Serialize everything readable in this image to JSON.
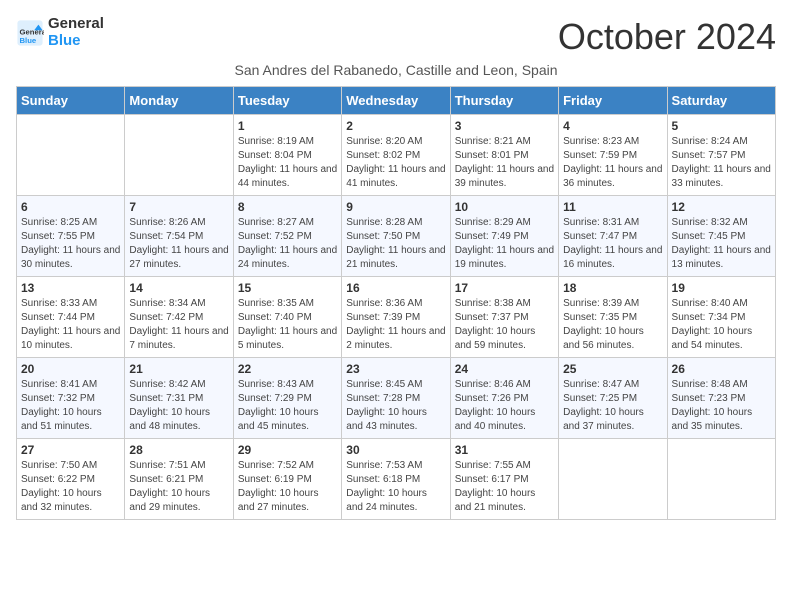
{
  "logo": {
    "line1": "General",
    "line2": "Blue"
  },
  "title": "October 2024",
  "subtitle": "San Andres del Rabanedo, Castille and Leon, Spain",
  "headers": [
    "Sunday",
    "Monday",
    "Tuesday",
    "Wednesday",
    "Thursday",
    "Friday",
    "Saturday"
  ],
  "weeks": [
    [
      {
        "day": "",
        "content": ""
      },
      {
        "day": "",
        "content": ""
      },
      {
        "day": "1",
        "content": "Sunrise: 8:19 AM\nSunset: 8:04 PM\nDaylight: 11 hours and 44 minutes."
      },
      {
        "day": "2",
        "content": "Sunrise: 8:20 AM\nSunset: 8:02 PM\nDaylight: 11 hours and 41 minutes."
      },
      {
        "day": "3",
        "content": "Sunrise: 8:21 AM\nSunset: 8:01 PM\nDaylight: 11 hours and 39 minutes."
      },
      {
        "day": "4",
        "content": "Sunrise: 8:23 AM\nSunset: 7:59 PM\nDaylight: 11 hours and 36 minutes."
      },
      {
        "day": "5",
        "content": "Sunrise: 8:24 AM\nSunset: 7:57 PM\nDaylight: 11 hours and 33 minutes."
      }
    ],
    [
      {
        "day": "6",
        "content": "Sunrise: 8:25 AM\nSunset: 7:55 PM\nDaylight: 11 hours and 30 minutes."
      },
      {
        "day": "7",
        "content": "Sunrise: 8:26 AM\nSunset: 7:54 PM\nDaylight: 11 hours and 27 minutes."
      },
      {
        "day": "8",
        "content": "Sunrise: 8:27 AM\nSunset: 7:52 PM\nDaylight: 11 hours and 24 minutes."
      },
      {
        "day": "9",
        "content": "Sunrise: 8:28 AM\nSunset: 7:50 PM\nDaylight: 11 hours and 21 minutes."
      },
      {
        "day": "10",
        "content": "Sunrise: 8:29 AM\nSunset: 7:49 PM\nDaylight: 11 hours and 19 minutes."
      },
      {
        "day": "11",
        "content": "Sunrise: 8:31 AM\nSunset: 7:47 PM\nDaylight: 11 hours and 16 minutes."
      },
      {
        "day": "12",
        "content": "Sunrise: 8:32 AM\nSunset: 7:45 PM\nDaylight: 11 hours and 13 minutes."
      }
    ],
    [
      {
        "day": "13",
        "content": "Sunrise: 8:33 AM\nSunset: 7:44 PM\nDaylight: 11 hours and 10 minutes."
      },
      {
        "day": "14",
        "content": "Sunrise: 8:34 AM\nSunset: 7:42 PM\nDaylight: 11 hours and 7 minutes."
      },
      {
        "day": "15",
        "content": "Sunrise: 8:35 AM\nSunset: 7:40 PM\nDaylight: 11 hours and 5 minutes."
      },
      {
        "day": "16",
        "content": "Sunrise: 8:36 AM\nSunset: 7:39 PM\nDaylight: 11 hours and 2 minutes."
      },
      {
        "day": "17",
        "content": "Sunrise: 8:38 AM\nSunset: 7:37 PM\nDaylight: 10 hours and 59 minutes."
      },
      {
        "day": "18",
        "content": "Sunrise: 8:39 AM\nSunset: 7:35 PM\nDaylight: 10 hours and 56 minutes."
      },
      {
        "day": "19",
        "content": "Sunrise: 8:40 AM\nSunset: 7:34 PM\nDaylight: 10 hours and 54 minutes."
      }
    ],
    [
      {
        "day": "20",
        "content": "Sunrise: 8:41 AM\nSunset: 7:32 PM\nDaylight: 10 hours and 51 minutes."
      },
      {
        "day": "21",
        "content": "Sunrise: 8:42 AM\nSunset: 7:31 PM\nDaylight: 10 hours and 48 minutes."
      },
      {
        "day": "22",
        "content": "Sunrise: 8:43 AM\nSunset: 7:29 PM\nDaylight: 10 hours and 45 minutes."
      },
      {
        "day": "23",
        "content": "Sunrise: 8:45 AM\nSunset: 7:28 PM\nDaylight: 10 hours and 43 minutes."
      },
      {
        "day": "24",
        "content": "Sunrise: 8:46 AM\nSunset: 7:26 PM\nDaylight: 10 hours and 40 minutes."
      },
      {
        "day": "25",
        "content": "Sunrise: 8:47 AM\nSunset: 7:25 PM\nDaylight: 10 hours and 37 minutes."
      },
      {
        "day": "26",
        "content": "Sunrise: 8:48 AM\nSunset: 7:23 PM\nDaylight: 10 hours and 35 minutes."
      }
    ],
    [
      {
        "day": "27",
        "content": "Sunrise: 7:50 AM\nSunset: 6:22 PM\nDaylight: 10 hours and 32 minutes."
      },
      {
        "day": "28",
        "content": "Sunrise: 7:51 AM\nSunset: 6:21 PM\nDaylight: 10 hours and 29 minutes."
      },
      {
        "day": "29",
        "content": "Sunrise: 7:52 AM\nSunset: 6:19 PM\nDaylight: 10 hours and 27 minutes."
      },
      {
        "day": "30",
        "content": "Sunrise: 7:53 AM\nSunset: 6:18 PM\nDaylight: 10 hours and 24 minutes."
      },
      {
        "day": "31",
        "content": "Sunrise: 7:55 AM\nSunset: 6:17 PM\nDaylight: 10 hours and 21 minutes."
      },
      {
        "day": "",
        "content": ""
      },
      {
        "day": "",
        "content": ""
      }
    ]
  ]
}
